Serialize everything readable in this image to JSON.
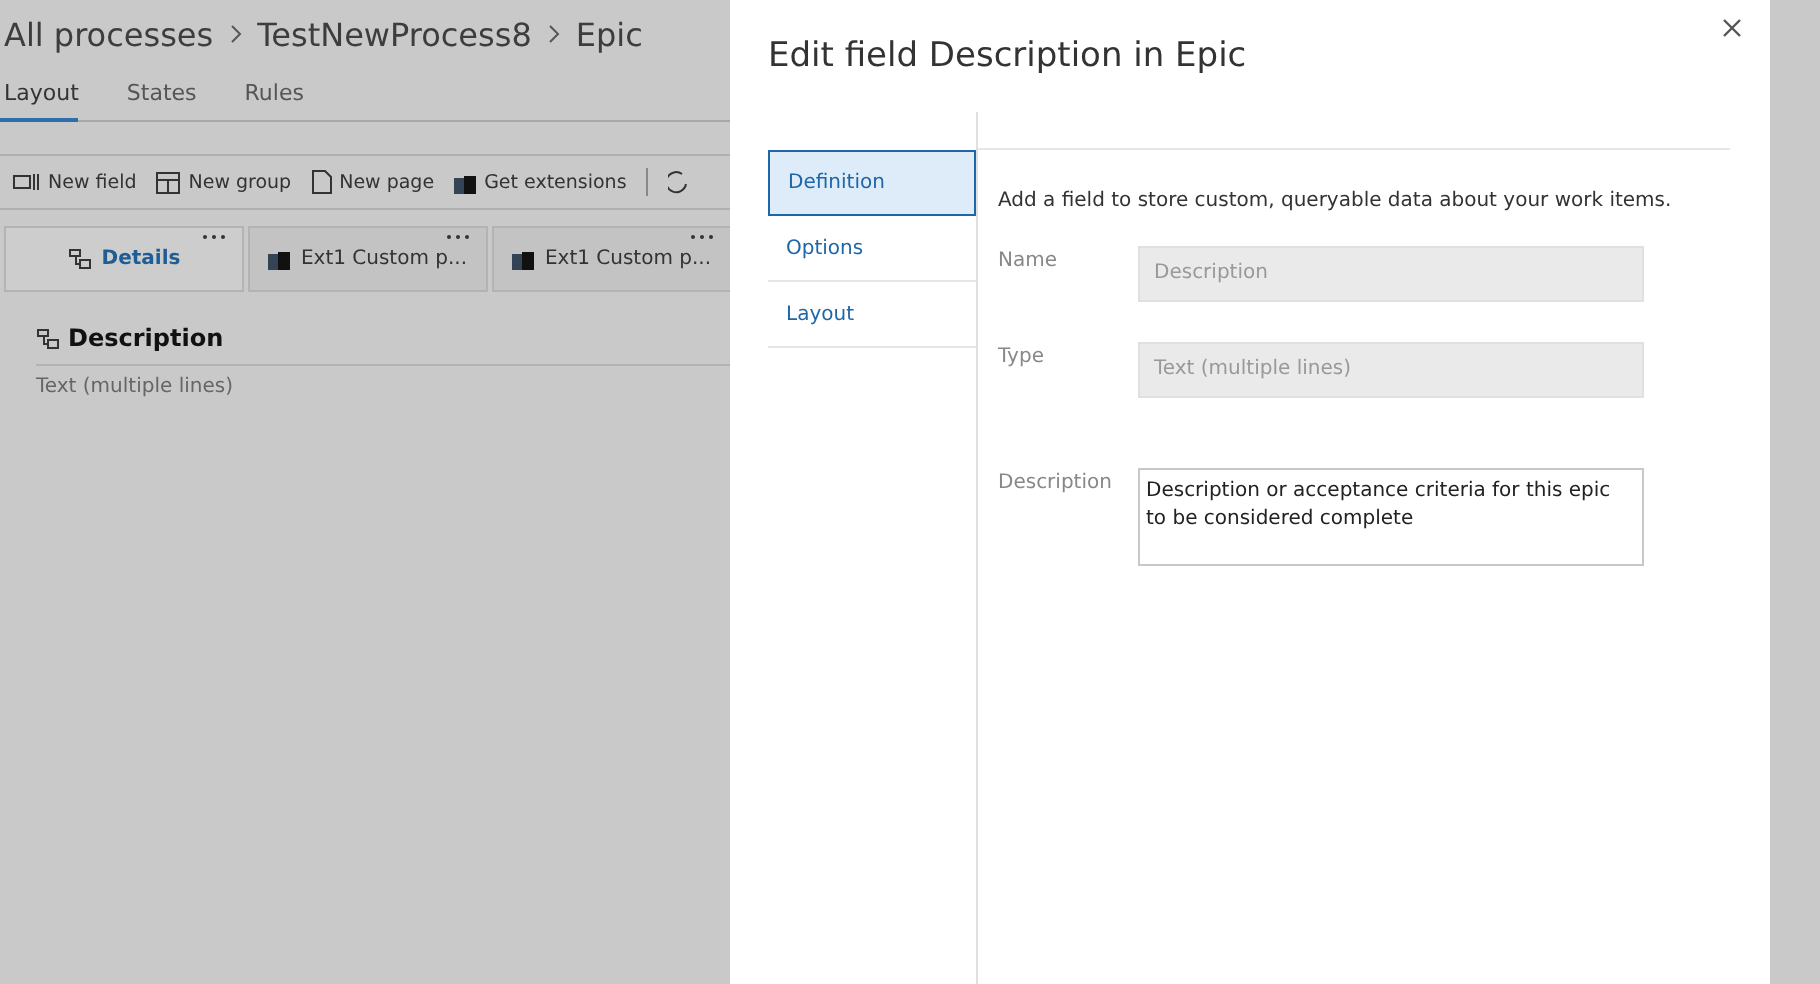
{
  "breadcrumb": [
    "All processes",
    "TestNewProcess8",
    "Epic"
  ],
  "tabs": [
    {
      "label": "Layout",
      "selected": true
    },
    {
      "label": "States",
      "selected": false
    },
    {
      "label": "Rules",
      "selected": false
    }
  ],
  "toolbar": [
    {
      "kind": "field",
      "label": "New field"
    },
    {
      "kind": "group",
      "label": "New group"
    },
    {
      "kind": "page",
      "label": "New page"
    },
    {
      "kind": "extensions",
      "label": "Get extensions"
    }
  ],
  "pages": [
    {
      "label": "Details",
      "kind": "group",
      "selected": true
    },
    {
      "label": "Ext1 Custom p...",
      "kind": "extension",
      "selected": false
    },
    {
      "label": "Ext1 Custom p...",
      "kind": "extension",
      "selected": false
    }
  ],
  "group": {
    "title": "Description",
    "field": "Text (multiple lines)"
  },
  "dialog": {
    "title": "Edit field Description in Epic",
    "nav": [
      {
        "label": "Definition",
        "selected": true
      },
      {
        "label": "Options",
        "selected": false
      },
      {
        "label": "Layout",
        "selected": false
      }
    ],
    "intro": "Add a field to store custom, queryable data about your work items.",
    "fields": [
      {
        "label": "Name",
        "value": "Description",
        "disabled": true
      },
      {
        "label": "Type",
        "value": "Text (multiple lines)",
        "disabled": true
      },
      {
        "label": "Description",
        "value": "Description or acceptance criteria for this epic to be considered complete",
        "disabled": false
      }
    ]
  }
}
